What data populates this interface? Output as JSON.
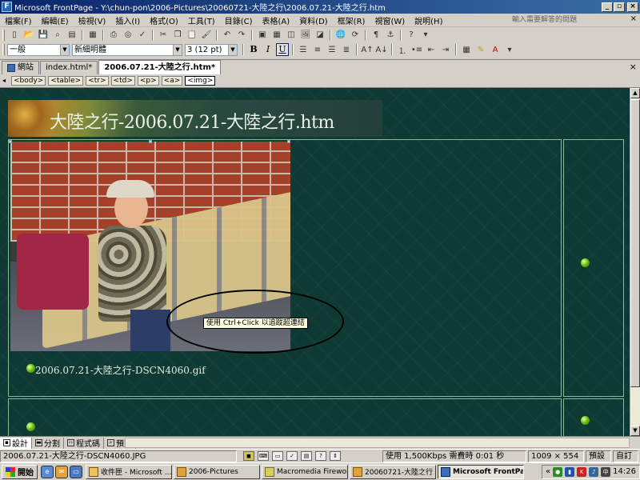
{
  "window": {
    "title": "Microsoft FrontPage - Y:\\chun-pon\\2006-Pictures\\20060721-大陸之行\\2006.07.21-大陸之行.htm",
    "app_icon_glyph": "F"
  },
  "menu": {
    "items": [
      "檔案(F)",
      "編輯(E)",
      "檢視(V)",
      "插入(I)",
      "格式(O)",
      "工具(T)",
      "目錄(C)",
      "表格(A)",
      "資料(D)",
      "框架(R)",
      "視窗(W)",
      "說明(H)"
    ],
    "help_placeholder": "輸入需要解答的問題",
    "help_close": "×"
  },
  "formatting": {
    "style": "一般",
    "font": "新細明體",
    "size": "3 (12 pt)",
    "bold": "B",
    "italic": "I",
    "underline": "U"
  },
  "tabs": {
    "site": "網站",
    "items": [
      "index.html*",
      "2006.07.21-大陸之行.htm*"
    ],
    "close": "×"
  },
  "quicktags": [
    "<body>",
    "<table>",
    "<tr>",
    "<td>",
    "<p>",
    "<a>",
    "<img>"
  ],
  "page": {
    "banner_title": "大陸之行-2006.07.21-大陸之行.htm",
    "caption": "2006.07.21-大陸之行-DSCN4060.gif",
    "tooltip": "使用 Ctrl+Click 以追蹤超連結"
  },
  "viewtabs": [
    {
      "label": "設計",
      "icon": "design-view-icon"
    },
    {
      "label": "分割",
      "icon": "split-view-icon"
    },
    {
      "label": "程式碼",
      "icon": "code-view-icon"
    },
    {
      "label": "預覽",
      "icon": "preview-icon"
    }
  ],
  "statusbar": {
    "filename": "2006.07.21-大陸之行-DSCN4060.JPG",
    "speed": "使用 1,500Kbps 需費時 0:01 秒",
    "dimensions": "1009 × 554",
    "mode1": "預設",
    "mode2": "自訂"
  },
  "taskbar": {
    "start": "開始",
    "tasks": [
      "收件匣 - Microsoft ...",
      "2006-Pictures",
      "Macromedia Firewor...",
      "20060721-大陸之行",
      "Microsoft FrontPage ..."
    ],
    "clock": "14:26",
    "tray_chevron": "«"
  }
}
